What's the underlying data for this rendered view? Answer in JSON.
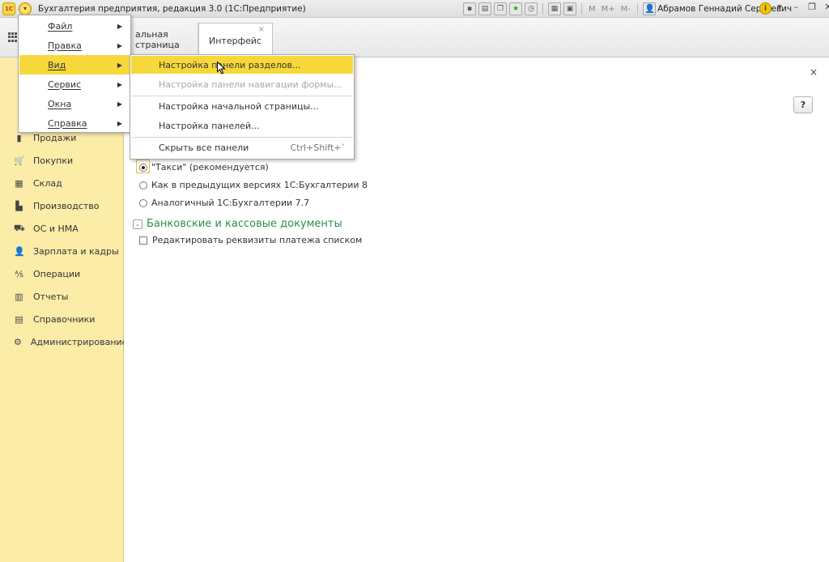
{
  "titlebar": {
    "logo": "1С",
    "title": "Бухгалтерия предприятия, редакция 3.0  (1С:Предприятие)",
    "letters": [
      "M",
      "M+",
      "M-"
    ],
    "user": "Абрамов Геннадий Сергеевич",
    "info": "i",
    "icons": [
      "disk-icon",
      "print-icon",
      "copy-icon",
      "favorite-star-icon",
      "history-icon",
      "calculator-icon",
      "calendar-icon",
      "panel-icon"
    ]
  },
  "tabs": {
    "home": "альная страница",
    "active": "Интерфейс",
    "close": "×"
  },
  "sidebar": {
    "items": [
      {
        "label": "Продажи",
        "icon": "▮"
      },
      {
        "label": "Покупки",
        "icon": "🛒"
      },
      {
        "label": "Склад",
        "icon": "▦"
      },
      {
        "label": "Производство",
        "icon": "▙"
      },
      {
        "label": "ОС и НМА",
        "icon": "⛟"
      },
      {
        "label": "Зарплата и кадры",
        "icon": "👤"
      },
      {
        "label": "Операции",
        "icon": "⅍"
      },
      {
        "label": "Отчеты",
        "icon": "▥"
      },
      {
        "label": "Справочники",
        "icon": "▤"
      },
      {
        "label": "Администрирование",
        "icon": "⚙"
      }
    ]
  },
  "main_menu": {
    "items": [
      {
        "label": "Файл"
      },
      {
        "label": "Правка"
      },
      {
        "label": "Вид"
      },
      {
        "label": "Сервис"
      },
      {
        "label": "Окна"
      },
      {
        "label": "Справка"
      }
    ]
  },
  "submenu": {
    "items": [
      {
        "label": "Настройка панели разделов..."
      },
      {
        "label": "Настройка панели навигации формы..."
      },
      {
        "label": "Настройка начальной страницы..."
      },
      {
        "label": "Настройка панелей..."
      },
      {
        "label": "Скрыть все панели",
        "shortcut": "Ctrl+Shift+`"
      }
    ]
  },
  "content": {
    "close": "×",
    "help": "?",
    "radio_options": [
      {
        "label": "\"Такси\" (рекомендуется)",
        "checked": true
      },
      {
        "label": "Как в предыдущих версиях 1С:Бухгалтерии 8",
        "checked": false
      },
      {
        "label": "Аналогичный 1С:Бухгалтерии 7.7",
        "checked": false
      }
    ],
    "group_title": "Банковские и кассовые документы",
    "checkbox_label": "Редактировать реквизиты платежа списком",
    "checkbox_checked": false
  },
  "colors": {
    "sidebar_bg": "#fbeca8",
    "highlight": "#f7d83a",
    "group_title": "#2a8f4a"
  }
}
